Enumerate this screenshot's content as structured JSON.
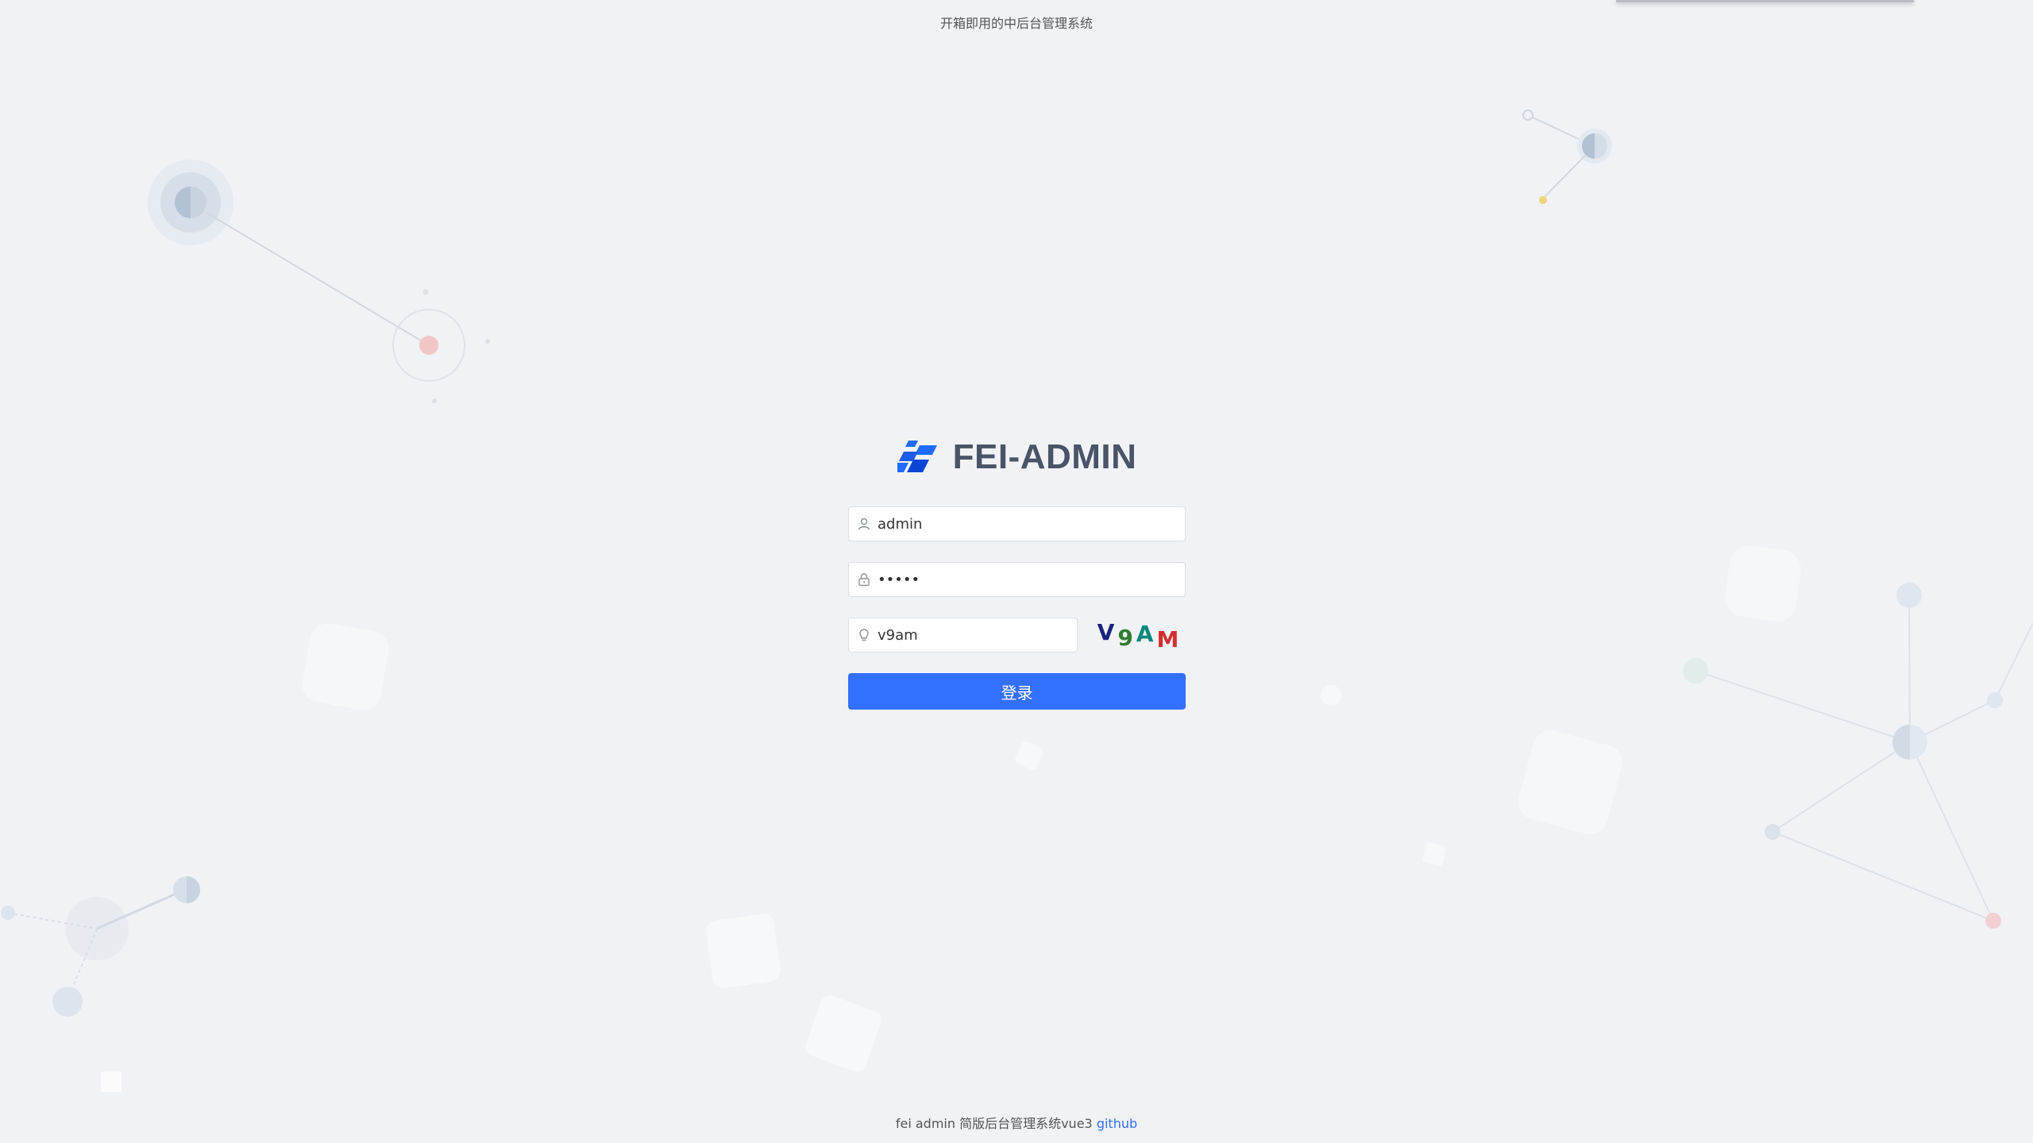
{
  "header": {
    "tagline": "开箱即用的中后台管理系统"
  },
  "login": {
    "title": "FEI-ADMIN",
    "username": {
      "value": "admin",
      "icon": "user-icon"
    },
    "password": {
      "value": "admin",
      "icon": "lock-icon"
    },
    "captcha": {
      "value": "v9am",
      "icon": "bulb-icon",
      "image_chars": [
        {
          "char": "V",
          "color": "#1a237e"
        },
        {
          "char": "9",
          "color": "#2e7d32"
        },
        {
          "char": "A",
          "color": "#00897b"
        },
        {
          "char": "M",
          "color": "#d32f2f"
        }
      ]
    },
    "submit_label": "登录"
  },
  "footer": {
    "text": "fei admin 简版后台管理系统vue3",
    "link_label": "github"
  },
  "colors": {
    "primary": "#3370ff",
    "background": "#f0f2f5",
    "title": "#4a5468"
  }
}
